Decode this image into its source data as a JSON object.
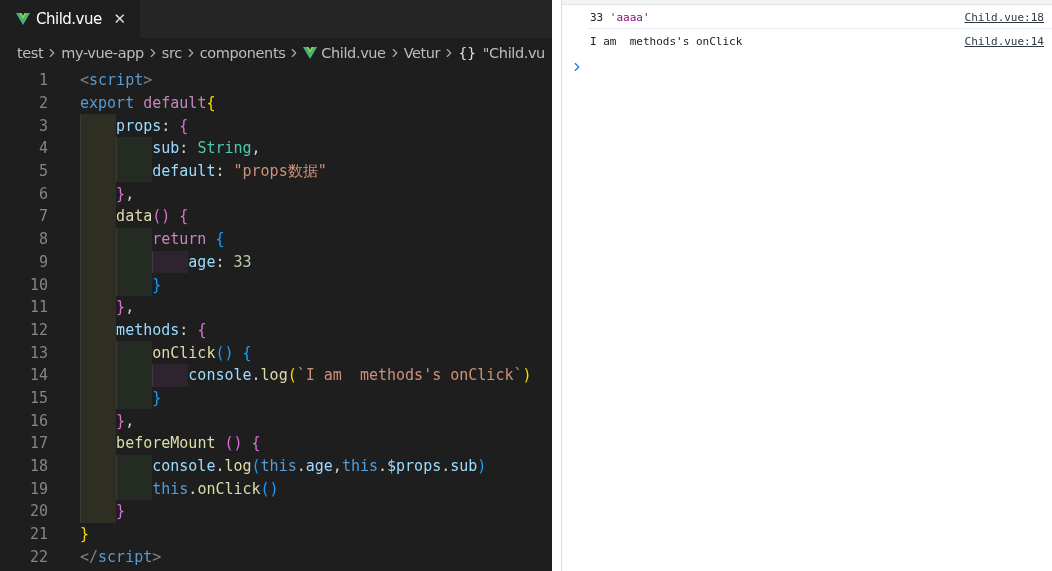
{
  "editor": {
    "tab": {
      "title": "Child.vue",
      "close": "✕",
      "selected": true
    },
    "breadcrumb": [
      {
        "text": "test",
        "kind": "folder"
      },
      {
        "text": "my-vue-app",
        "kind": "folder"
      },
      {
        "text": "src",
        "kind": "folder"
      },
      {
        "text": "components",
        "kind": "folder"
      },
      {
        "text": "Child.vue",
        "kind": "vue-file"
      },
      {
        "text": "Vetur",
        "kind": "folder"
      },
      {
        "text": "\"Child.vu",
        "kind": "symbol",
        "symbol": "{}"
      }
    ],
    "lines": [
      {
        "number": "1",
        "tokens": [
          {
            "text": "<",
            "kind": "punct"
          },
          {
            "text": "script",
            "kind": "tag"
          },
          {
            "text": ">",
            "kind": "punct"
          }
        ]
      },
      {
        "number": "2",
        "tokens": [
          {
            "text": "export ",
            "kind": "tag"
          },
          {
            "text": "default",
            "kind": "control"
          },
          {
            "text": "{",
            "kind": "bracket1"
          }
        ],
        "children": [
          {
            "number": "3",
            "tokens": [
              {
                "text": "props",
                "kind": "property"
              },
              {
                "text": ": ",
                "kind": "plain"
              },
              {
                "text": "{",
                "kind": "bracket2"
              }
            ],
            "children": [
              {
                "number": "4",
                "tokens": [
                  {
                    "text": "sub",
                    "kind": "property"
                  },
                  {
                    "text": ": ",
                    "kind": "plain"
                  },
                  {
                    "text": "String",
                    "kind": "type"
                  },
                  {
                    "text": ",",
                    "kind": "plain"
                  }
                ]
              },
              {
                "number": "5",
                "tokens": [
                  {
                    "text": "default",
                    "kind": "property"
                  },
                  {
                    "text": ": ",
                    "kind": "plain"
                  },
                  {
                    "text": "\"props数据\"",
                    "kind": "string"
                  }
                ]
              }
            ]
          },
          {
            "number": "6",
            "tokens": [
              {
                "text": "}",
                "kind": "bracket2"
              },
              {
                "text": ",",
                "kind": "plain"
              }
            ]
          },
          {
            "number": "7",
            "tokens": [
              {
                "text": "data",
                "kind": "function"
              },
              {
                "text": "() {",
                "kind": "bracket2"
              }
            ],
            "children": [
              {
                "number": "8",
                "tokens": [
                  {
                    "text": "return",
                    "kind": "control"
                  },
                  {
                    "text": " {",
                    "kind": "bracket3"
                  }
                ],
                "children": [
                  {
                    "number": "9",
                    "tokens": [
                      {
                        "text": "age",
                        "kind": "property"
                      },
                      {
                        "text": ": ",
                        "kind": "plain"
                      },
                      {
                        "text": "33",
                        "kind": "number"
                      }
                    ]
                  }
                ]
              },
              {
                "number": "10",
                "tokens": [
                  {
                    "text": "}",
                    "kind": "bracket3"
                  }
                ]
              }
            ]
          },
          {
            "number": "11",
            "tokens": [
              {
                "text": "}",
                "kind": "bracket2"
              },
              {
                "text": ",",
                "kind": "plain"
              }
            ]
          },
          {
            "number": "12",
            "tokens": [
              {
                "text": "methods",
                "kind": "property"
              },
              {
                "text": ": ",
                "kind": "plain"
              },
              {
                "text": "{",
                "kind": "bracket2"
              }
            ],
            "children": [
              {
                "number": "13",
                "tokens": [
                  {
                    "text": "onClick",
                    "kind": "function"
                  },
                  {
                    "text": "() {",
                    "kind": "bracket3"
                  }
                ],
                "children": [
                  {
                    "number": "14",
                    "tokens": [
                      {
                        "text": "console",
                        "kind": "property"
                      },
                      {
                        "text": ".",
                        "kind": "plain"
                      },
                      {
                        "text": "log",
                        "kind": "function"
                      },
                      {
                        "text": "(",
                        "kind": "bracket1"
                      },
                      {
                        "text": "`I am  methods's onClick`",
                        "kind": "string"
                      },
                      {
                        "text": ")",
                        "kind": "bracket1"
                      }
                    ]
                  }
                ]
              },
              {
                "number": "15",
                "tokens": [
                  {
                    "text": "}",
                    "kind": "bracket3"
                  }
                ]
              }
            ]
          },
          {
            "number": "16",
            "tokens": [
              {
                "text": "}",
                "kind": "bracket2"
              },
              {
                "text": ",",
                "kind": "plain"
              }
            ]
          },
          {
            "number": "17",
            "tokens": [
              {
                "text": "beforeMount",
                "kind": "function"
              },
              {
                "text": " () {",
                "kind": "bracket2"
              }
            ],
            "children": [
              {
                "number": "18",
                "tokens": [
                  {
                    "text": "console",
                    "kind": "property"
                  },
                  {
                    "text": ".",
                    "kind": "plain"
                  },
                  {
                    "text": "log",
                    "kind": "function"
                  },
                  {
                    "text": "(",
                    "kind": "bracket3"
                  },
                  {
                    "text": "this",
                    "kind": "tag"
                  },
                  {
                    "text": ".",
                    "kind": "plain"
                  },
                  {
                    "text": "age",
                    "kind": "property"
                  },
                  {
                    "text": ",",
                    "kind": "plain"
                  },
                  {
                    "text": "this",
                    "kind": "tag"
                  },
                  {
                    "text": ".",
                    "kind": "plain"
                  },
                  {
                    "text": "$props",
                    "kind": "property"
                  },
                  {
                    "text": ".",
                    "kind": "plain"
                  },
                  {
                    "text": "sub",
                    "kind": "property"
                  },
                  {
                    "text": ")",
                    "kind": "bracket3"
                  }
                ]
              },
              {
                "number": "19",
                "tokens": [
                  {
                    "text": "this",
                    "kind": "tag"
                  },
                  {
                    "text": ".",
                    "kind": "plain"
                  },
                  {
                    "text": "onClick",
                    "kind": "function"
                  },
                  {
                    "text": "()",
                    "kind": "bracket3"
                  }
                ]
              }
            ]
          },
          {
            "number": "20",
            "tokens": [
              {
                "text": "}",
                "kind": "bracket2"
              }
            ]
          }
        ]
      },
      {
        "number": "21",
        "tokens": [
          {
            "text": "}",
            "kind": "bracket1"
          }
        ]
      },
      {
        "number": "22",
        "tokens": [
          {
            "text": "</",
            "kind": "punct"
          },
          {
            "text": "script",
            "kind": "tag"
          },
          {
            "text": ">",
            "kind": "punct"
          }
        ]
      }
    ]
  },
  "console": {
    "messages": [
      {
        "parts": [
          {
            "text": "33",
            "kind": "plain"
          },
          {
            "text": "'aaaa'",
            "kind": "string"
          }
        ],
        "source": "Child.vue:18"
      },
      {
        "parts": [
          {
            "text": "I am  methods's onClick",
            "kind": "plain"
          }
        ],
        "source": "Child.vue:14"
      }
    ]
  }
}
